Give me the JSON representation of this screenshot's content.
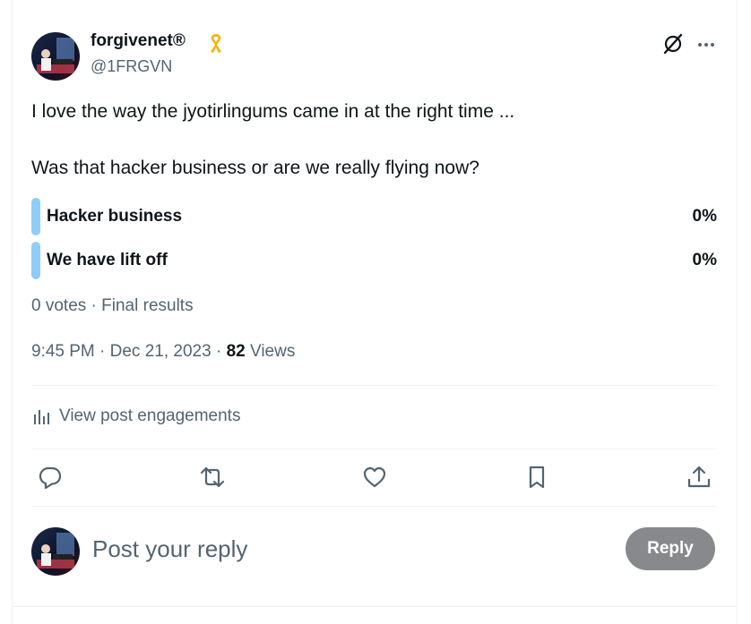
{
  "post": {
    "author": {
      "display_name": "forgivenet®",
      "handle": "@1FRGVN",
      "badge_icon": "yellow-ribbon-icon",
      "badge_color": "#f4b400"
    },
    "text_lines": [
      "I love the way the jyotirlingums came in at the right time ...",
      "Was that hacker business or are we really flying now?"
    ],
    "poll": {
      "options": [
        {
          "label": "Hacker business",
          "percent": "0%"
        },
        {
          "label": "We have lift off",
          "percent": "0%"
        }
      ],
      "bar_color": "#8ecdf8",
      "votes": "0 votes",
      "status": "Final results"
    },
    "timestamp": "9:45 PM · Dec 21, 2023",
    "views_count": "82",
    "views_label": "Views",
    "engagements_label": "View post engagements",
    "header_icons": [
      "grok-icon",
      "more-icon"
    ],
    "actions": [
      "reply-icon",
      "retweet-icon",
      "like-icon",
      "bookmark-icon",
      "share-icon"
    ]
  },
  "reply_composer": {
    "placeholder": "Post your reply",
    "button_label": "Reply",
    "button_color": "#87898c"
  },
  "colors": {
    "text_primary": "#0f1419",
    "text_secondary": "#536471",
    "divider": "#eff3f4"
  }
}
